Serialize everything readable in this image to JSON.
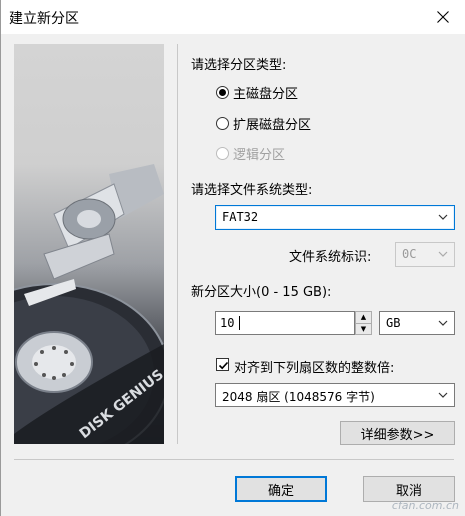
{
  "window": {
    "title": "建立新分区"
  },
  "partition_type": {
    "label": "请选择分区类型:",
    "options": [
      {
        "label": "主磁盘分区",
        "selected": true,
        "enabled": true
      },
      {
        "label": "扩展磁盘分区",
        "selected": false,
        "enabled": true
      },
      {
        "label": "逻辑分区",
        "selected": false,
        "enabled": false
      }
    ]
  },
  "filesystem": {
    "label": "请选择文件系统类型:",
    "value": "FAT32",
    "id_label": "文件系统标识:",
    "id_value": "0C"
  },
  "size": {
    "label": "新分区大小(0 - 15 GB):",
    "value": "10",
    "unit": "GB"
  },
  "align": {
    "checked": true,
    "label": "对齐到下列扇区数的整数倍:",
    "value": "2048 扇区 (1048576 字节)"
  },
  "buttons": {
    "details": "详细参数>>",
    "ok": "确定",
    "cancel": "取消"
  },
  "art_text": "DISK GENIUS",
  "watermark": "cfan.com.cn"
}
